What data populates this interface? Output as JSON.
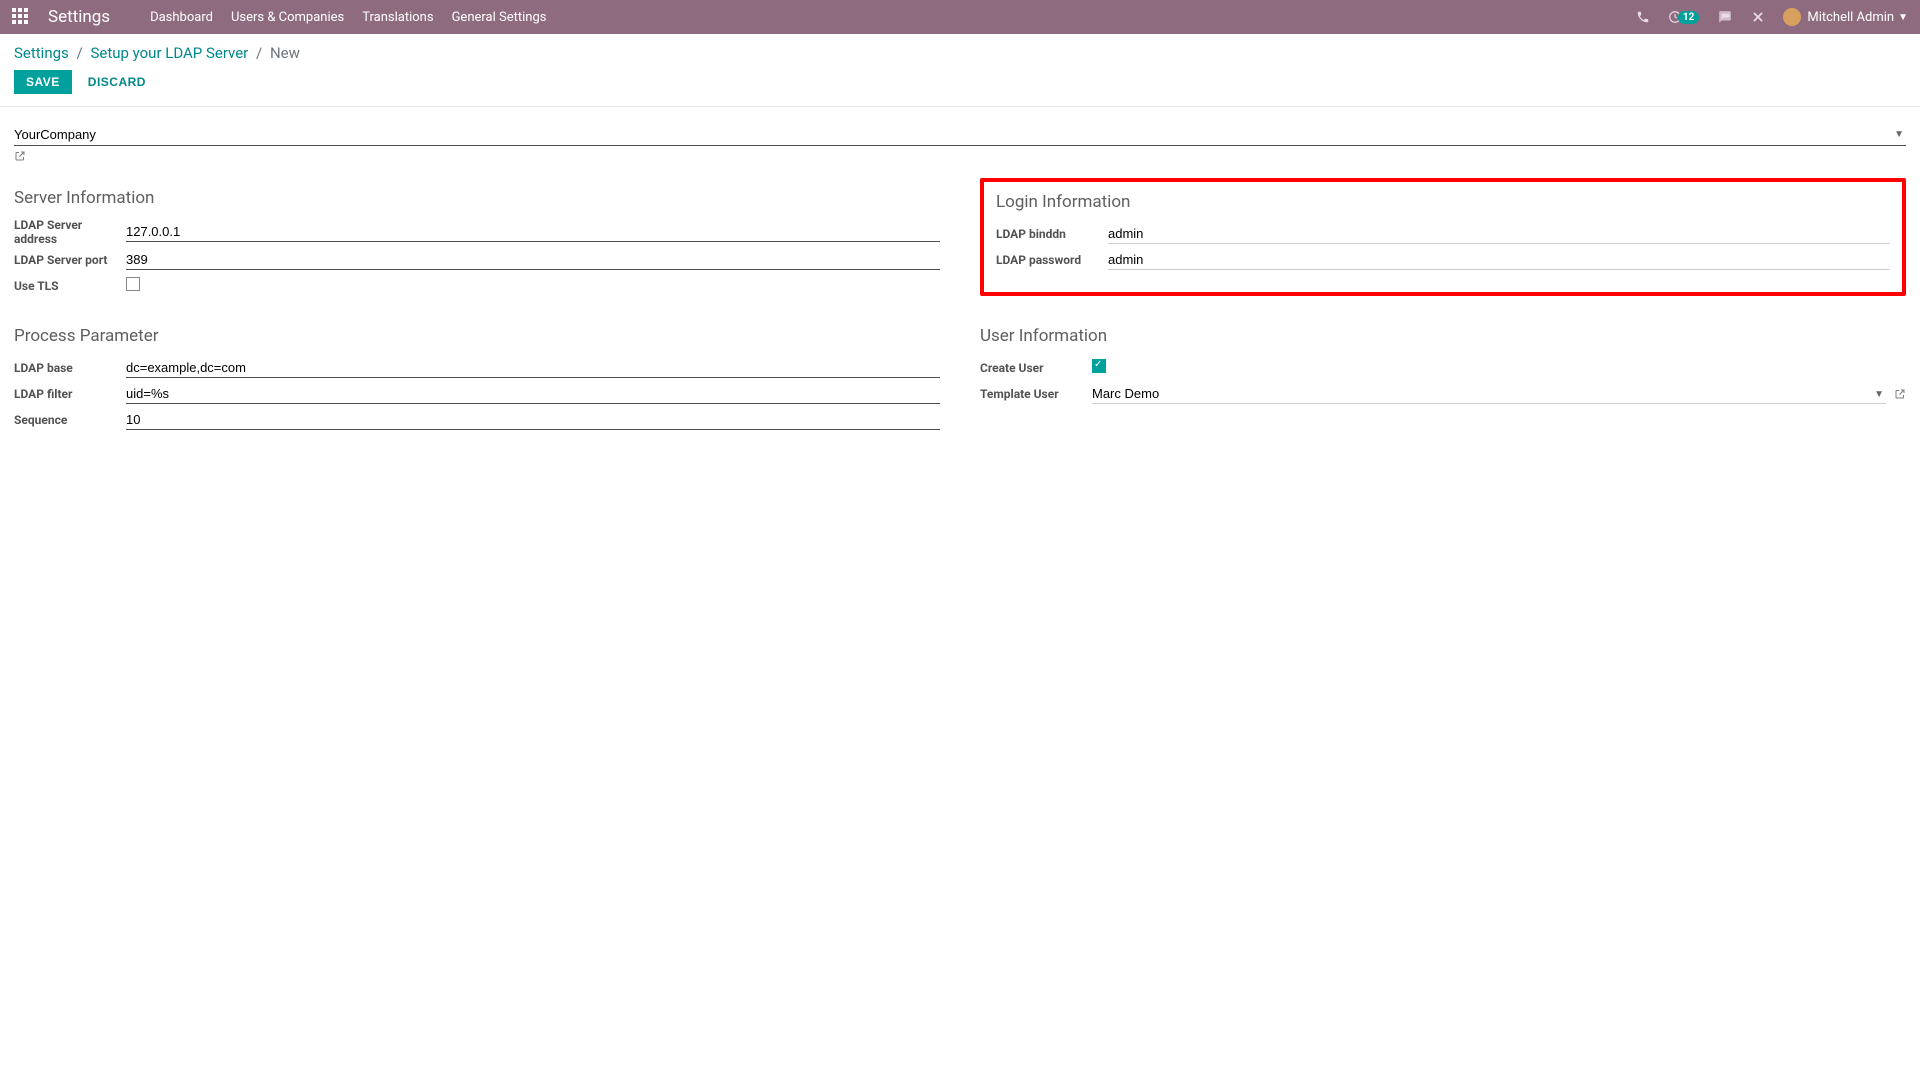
{
  "topbar": {
    "app_title": "Settings",
    "nav": [
      "Dashboard",
      "Users & Companies",
      "Translations",
      "General Settings"
    ],
    "activity_count": "12",
    "user_name": "Mitchell Admin"
  },
  "breadcrumb": {
    "root": "Settings",
    "mid": "Setup your LDAP Server",
    "current": "New"
  },
  "buttons": {
    "save": "SAVE",
    "discard": "DISCARD"
  },
  "company": {
    "value": "YourCompany"
  },
  "server_info": {
    "title": "Server Information",
    "labels": {
      "address": "LDAP Server address",
      "port": "LDAP Server port",
      "tls": "Use TLS"
    },
    "values": {
      "address": "127.0.0.1",
      "port": "389",
      "tls_checked": false
    }
  },
  "login_info": {
    "title": "Login Information",
    "labels": {
      "binddn": "LDAP binddn",
      "password": "LDAP password"
    },
    "values": {
      "binddn": "admin",
      "password": "admin"
    }
  },
  "process_param": {
    "title": "Process Parameter",
    "labels": {
      "base": "LDAP base",
      "filter": "LDAP filter",
      "sequence": "Sequence"
    },
    "values": {
      "base": "dc=example,dc=com",
      "filter": "uid=%s",
      "sequence": "10"
    }
  },
  "user_info": {
    "title": "User Information",
    "labels": {
      "create_user": "Create User",
      "template_user": "Template User"
    },
    "values": {
      "create_user_checked": true,
      "template_user": "Marc Demo"
    }
  }
}
